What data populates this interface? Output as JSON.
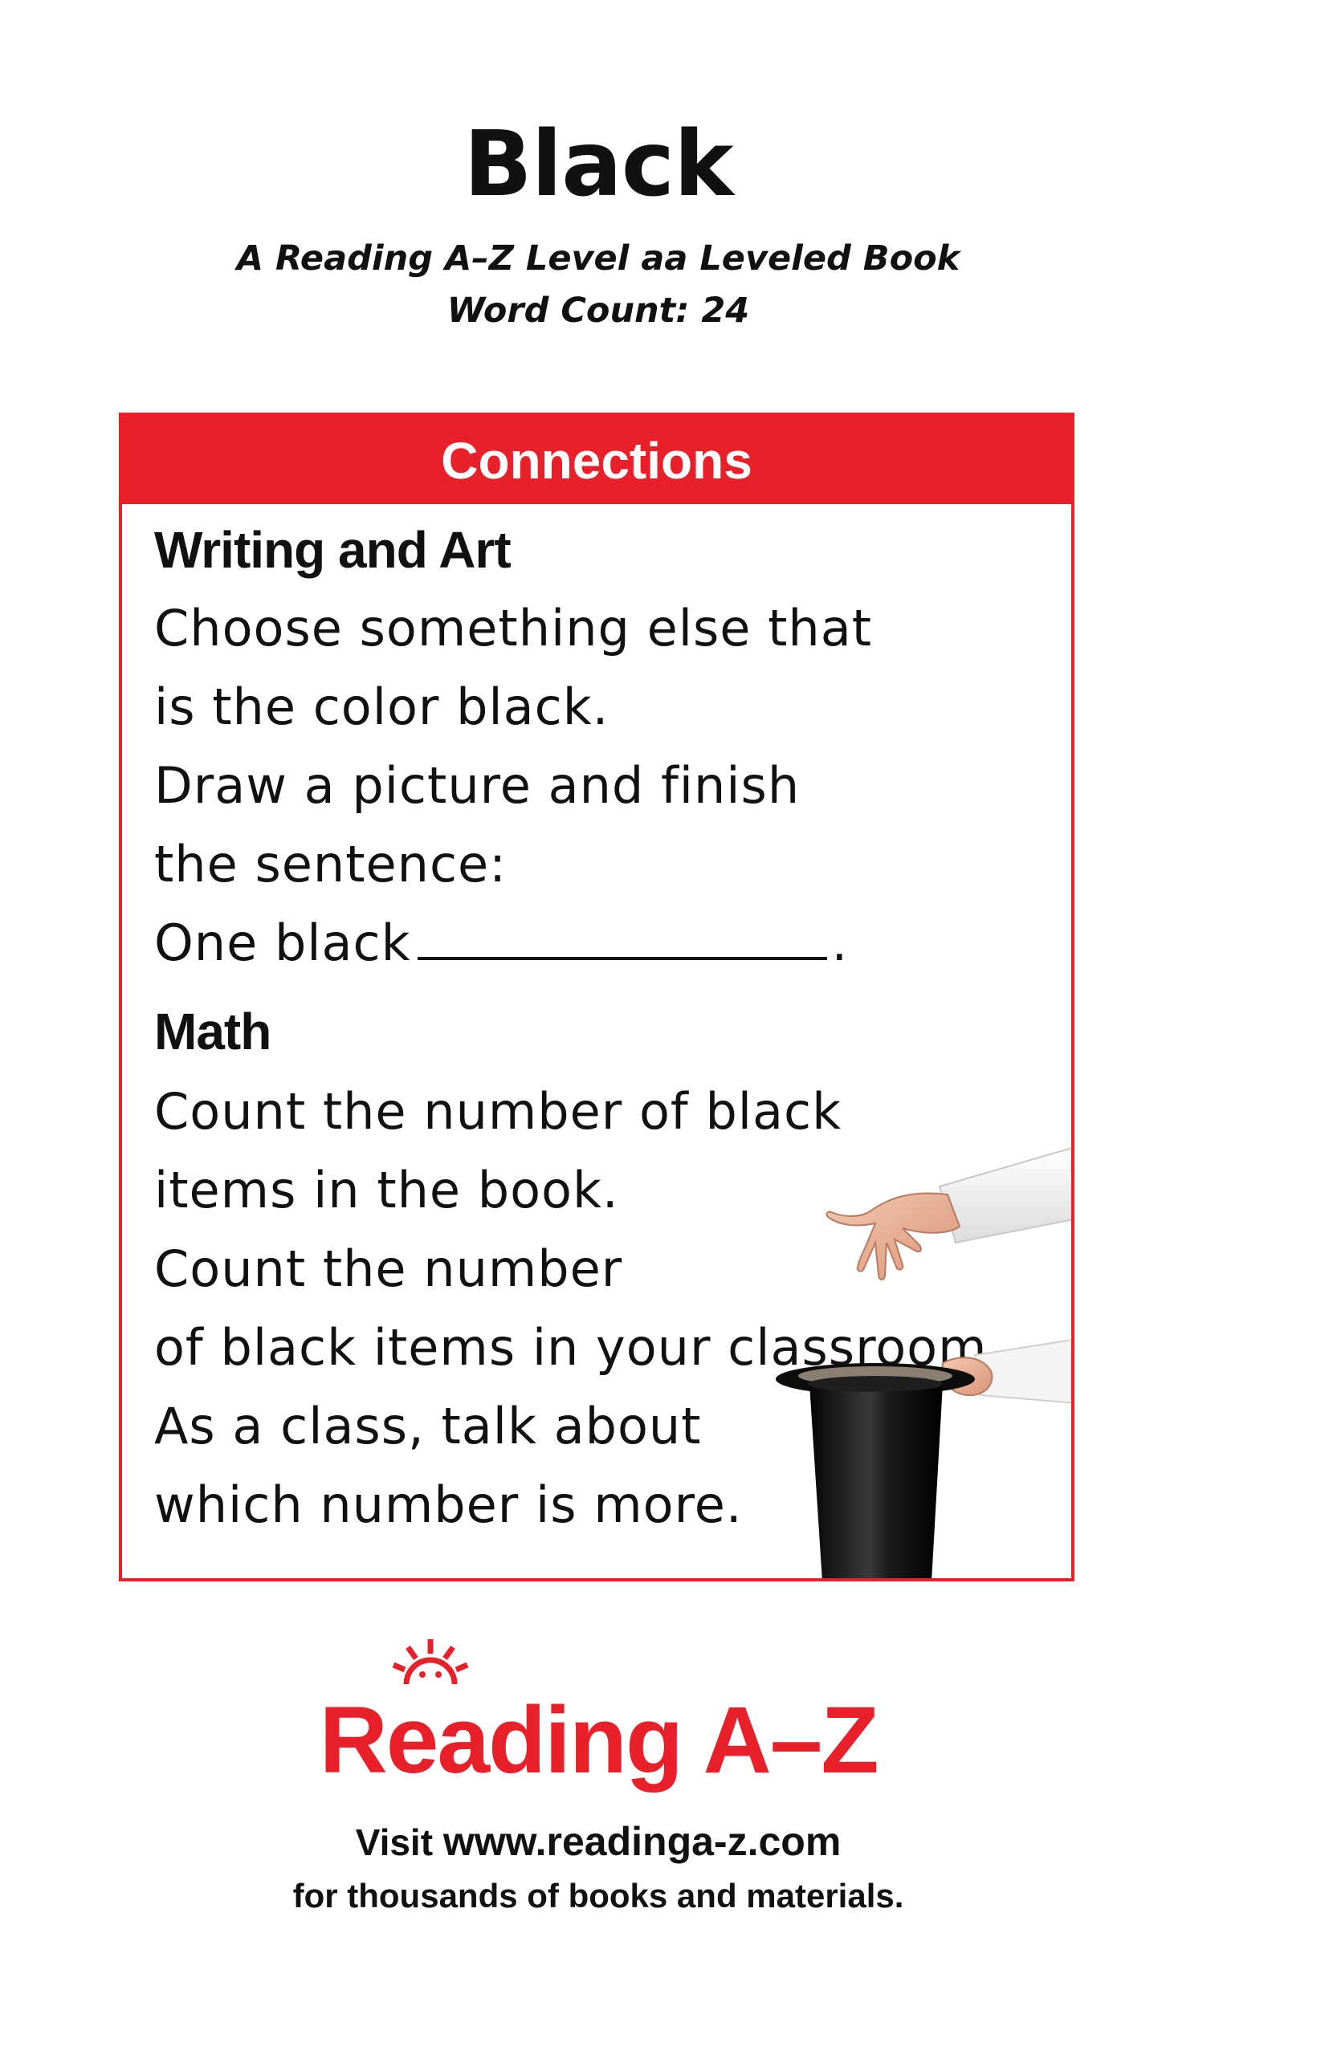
{
  "book": {
    "title": "Black",
    "subtitle": "A Reading A–Z Level aa Leveled Book",
    "word_count": "Word Count: 24"
  },
  "connections": {
    "header": "Connections",
    "writing_and_art": {
      "heading": "Writing and Art",
      "lines": [
        "Choose something else that",
        "is the color black.",
        "Draw a picture and finish",
        "the sentence:"
      ],
      "sentence_start": "One black",
      "sentence_end": "."
    },
    "math": {
      "heading": "Math",
      "lines": [
        "Count the number of black",
        "items in the book.",
        "Count the number",
        "of black items in your classroom.",
        "As a class, talk about",
        "which number is more."
      ]
    }
  },
  "footer": {
    "logo_text": "Reading A–Z",
    "visit_prefix": "Visit",
    "url": "www.readinga-z.com",
    "tagline": "for thousands of books and materials."
  },
  "colors": {
    "accent": "#e8202a"
  },
  "icons": {
    "logo": "sun-icon",
    "illustration": "magician-hand-and-top-hat"
  }
}
